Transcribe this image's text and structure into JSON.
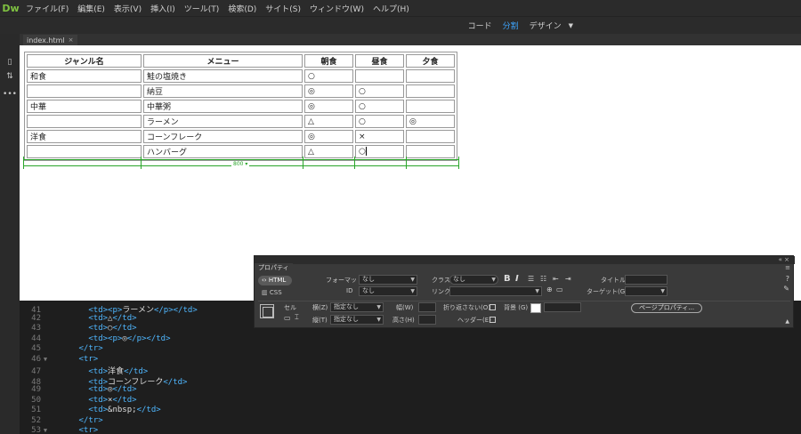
{
  "app": {
    "logo": "Dw"
  },
  "menubar": {
    "items": [
      "ファイル(F)",
      "編集(E)",
      "表示(V)",
      "挿入(I)",
      "ツール(T)",
      "検索(D)",
      "サイト(S)",
      "ウィンドウ(W)",
      "ヘルプ(H)"
    ]
  },
  "viewbar": {
    "code": "コード",
    "split": "分割",
    "design": "デザイン"
  },
  "tab": {
    "filename": "index.html",
    "close": "×"
  },
  "table": {
    "headers": [
      "ジャンル名",
      "メニュー",
      "朝食",
      "昼食",
      "夕食"
    ],
    "rows": [
      [
        "和食",
        "鮭の塩焼き",
        "○",
        "",
        ""
      ],
      [
        "",
        "納豆",
        "◎",
        "○",
        ""
      ],
      [
        "中華",
        "中華粥",
        "◎",
        "○",
        ""
      ],
      [
        "",
        "ラーメン",
        "△",
        "○",
        "◎"
      ],
      [
        "洋食",
        "コーンフレーク",
        "◎",
        "×",
        ""
      ],
      [
        "",
        "ハンバーグ",
        "△",
        "○",
        ""
      ]
    ],
    "width_label": "800 ▾"
  },
  "code": {
    "lines": [
      {
        "n": "41",
        "fold": "",
        "html": "        <td><p>ラーメン</p></td>"
      },
      {
        "n": "42",
        "fold": "",
        "html": "        <td>△</td>"
      },
      {
        "n": "43",
        "fold": "",
        "html": "        <td>○</td>"
      },
      {
        "n": "44",
        "fold": "",
        "html": "        <td><p>◎</p></td>"
      },
      {
        "n": "45",
        "fold": "",
        "html": "      </tr>"
      },
      {
        "n": "46",
        "fold": "▼",
        "html": "      <tr>"
      },
      {
        "n": "47",
        "fold": "",
        "html": "        <td>洋食</td>"
      },
      {
        "n": "48",
        "fold": "",
        "html": "        <td>コーンフレーク</td>"
      },
      {
        "n": "49",
        "fold": "",
        "html": "        <td>◎</td>"
      },
      {
        "n": "50",
        "fold": "",
        "html": "        <td>×</td>"
      },
      {
        "n": "51",
        "fold": "",
        "html": "        <td>&nbsp;</td>"
      },
      {
        "n": "52",
        "fold": "",
        "html": "      </tr>"
      },
      {
        "n": "53",
        "fold": "▼",
        "html": "      <tr>"
      }
    ]
  },
  "props": {
    "title": "プロパティ",
    "html_label": "HTML",
    "css_label": "CSS",
    "format_label": "フォーマット",
    "format_value": "なし",
    "class_label": "クラス",
    "class_value": "なし",
    "id_label": "ID",
    "id_value": "なし",
    "link_label": "リンク",
    "title_label": "タイトル",
    "target_label": "ターゲット(G)",
    "cell_label": "セル",
    "horz_label": "横(Z)",
    "horz_value": "指定なし",
    "vert_label": "縦(T)",
    "vert_value": "指定なし",
    "width_label": "幅(W)",
    "height_label": "高さ(H)",
    "nowrap_label": "折り返さない(O)",
    "header_label": "ヘッダー(E)",
    "bg_label": "背景 (G)",
    "page_props": "ページプロパティ..."
  }
}
